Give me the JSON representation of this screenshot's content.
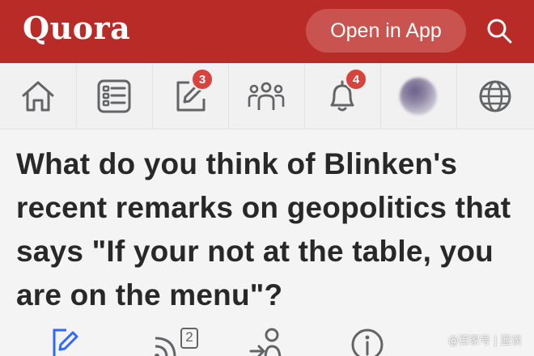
{
  "header": {
    "logo_text": "Quora",
    "open_app_label": "Open in App",
    "brand_color": "#b92b27",
    "search_icon": "search-icon"
  },
  "nav": {
    "items": [
      {
        "icon": "home-icon"
      },
      {
        "icon": "following-list-icon"
      },
      {
        "icon": "answer-edit-icon",
        "badge": "3"
      },
      {
        "icon": "spaces-icon"
      },
      {
        "icon": "bell-icon",
        "badge": "4"
      },
      {
        "icon": "avatar"
      },
      {
        "icon": "globe-icon"
      }
    ]
  },
  "question": {
    "title": "What do you think of Blinken's recent remarks on geopolitics that says \"If your not at the table, you are on the menu\"?"
  },
  "actions": [
    {
      "icon": "answer-pencil-icon"
    },
    {
      "icon": "follow-question-icon",
      "count": "2"
    },
    {
      "icon": "request-answer-icon"
    },
    {
      "icon": "info-icon"
    }
  ],
  "watermark": "@百家号 | 蓝谈"
}
